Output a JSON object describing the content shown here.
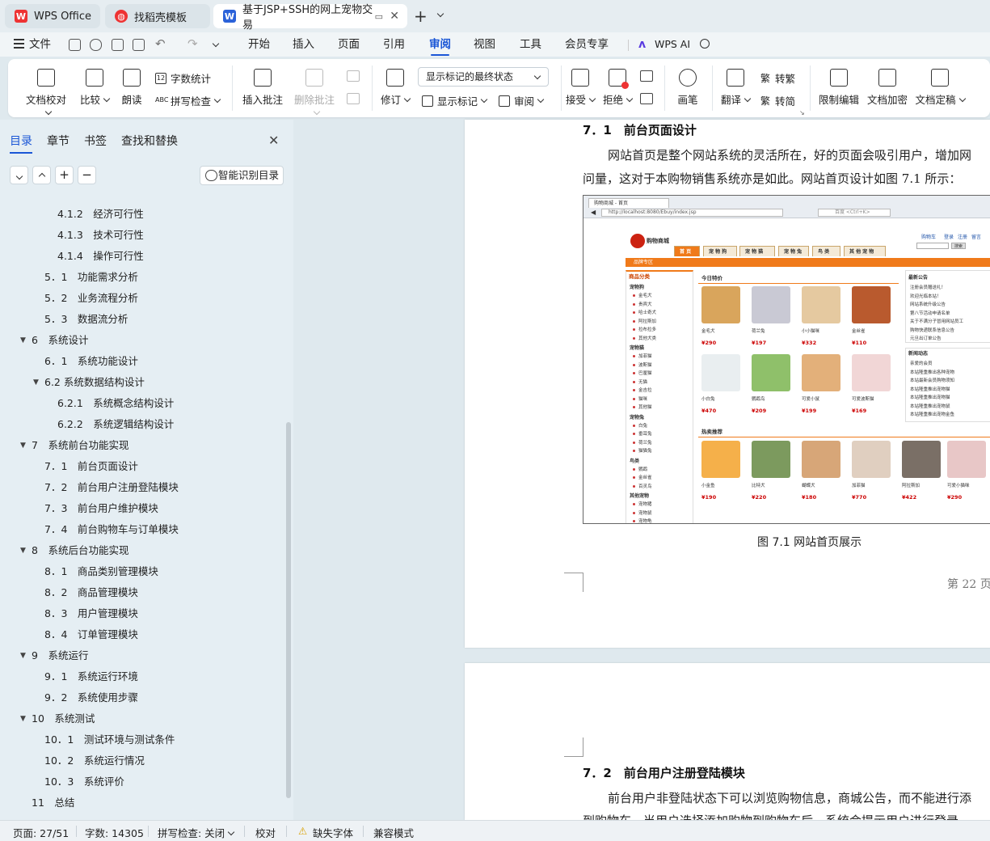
{
  "tabs": [
    {
      "label": "WPS Office"
    },
    {
      "label": "找稻壳模板"
    },
    {
      "label": "基于JSP+SSH的网上宠物交易"
    }
  ],
  "menu": {
    "file": "文件",
    "items": [
      "开始",
      "插入",
      "页面",
      "引用",
      "审阅",
      "视图",
      "工具",
      "会员专享"
    ],
    "active": "审阅",
    "ai": "WPS AI"
  },
  "ribbon": {
    "proofread": "文档校对",
    "compare": "比较",
    "read_aloud": "朗读",
    "word_count": "字数统计",
    "spell_check": "拼写检查",
    "insert_comment": "插入批注",
    "delete_comment": "删除批注",
    "revise": "修订",
    "mark_state": "显示标记的最终状态",
    "show_marks": "显示标记",
    "review": "审阅",
    "accept": "接受",
    "reject": "拒绝",
    "pen": "画笔",
    "translate": "翻译",
    "to_traditional": "转繁",
    "to_simplified": "转简",
    "restrict_edit": "限制编辑",
    "encrypt": "文档加密",
    "finalize": "文档定稿"
  },
  "sidebar": {
    "tabs": [
      "目录",
      "章节",
      "书签",
      "查找和替换"
    ],
    "active_tab": "目录",
    "smart_button": "智能识别目录",
    "toc": [
      {
        "text": "4.1.2　经济可行性",
        "level": 3
      },
      {
        "text": "4.1.3　技术可行性",
        "level": 3
      },
      {
        "text": "4.1.4　操作可行性",
        "level": 3
      },
      {
        "text": "5．1　功能需求分析",
        "level": 2
      },
      {
        "text": "5．2　业务流程分析",
        "level": 2
      },
      {
        "text": "5．3　数据流分析",
        "level": 2
      },
      {
        "text": "6　系统设计",
        "level": 1,
        "expanded": true
      },
      {
        "text": "6．1　系统功能设计",
        "level": 2
      },
      {
        "text": "6.2 系统数据结构设计",
        "level": 2,
        "expanded": true
      },
      {
        "text": "6.2.1　系统概念结构设计",
        "level": 3
      },
      {
        "text": "6.2.2　系统逻辑结构设计",
        "level": 3
      },
      {
        "text": "7　系统前台功能实现",
        "level": 1,
        "expanded": true
      },
      {
        "text": "7．1　前台页面设计",
        "level": 2
      },
      {
        "text": "7．2　前台用户注册登陆模块",
        "level": 2
      },
      {
        "text": "7．3　前台用户维护模块",
        "level": 2
      },
      {
        "text": "7．4　前台购物车与订单模块",
        "level": 2
      },
      {
        "text": "8　系统后台功能实现",
        "level": 1,
        "expanded": true
      },
      {
        "text": "8．1　商品类别管理模块",
        "level": 2
      },
      {
        "text": "8．2　商品管理模块",
        "level": 2
      },
      {
        "text": "8．3　用户管理模块",
        "level": 2
      },
      {
        "text": "8．4　订单管理模块",
        "level": 2
      },
      {
        "text": "9　系统运行",
        "level": 1,
        "expanded": true
      },
      {
        "text": "9．1　系统运行环境",
        "level": 2
      },
      {
        "text": "9．2　系统使用步骤",
        "level": 2
      },
      {
        "text": "10　系统测试",
        "level": 1,
        "expanded": true
      },
      {
        "text": "10．1　测试环境与测试条件",
        "level": 2
      },
      {
        "text": "10．2　系统运行情况",
        "level": 2
      },
      {
        "text": "10．3　系统评价",
        "level": 2
      },
      {
        "text": "11　总结",
        "level": 1
      }
    ]
  },
  "document": {
    "heading1": "7．1　前台页面设计",
    "para1_line1": "网站首页是整个网站系统的灵活所在，好的页面会吸引用户，增加网",
    "para1_line2": "问量，这对于本购物销售系统亦是如此。网站首页设计如图 7.1 所示：",
    "caption": "图 7.1  网站首页展示",
    "page_number": "第 22 页",
    "heading2": "7．2　前台用户注册登陆模块",
    "para2_line1": "前台用户非登陆状态下可以浏览购物信息，商城公告，而不能进行添",
    "para2_line2": "到购物车，当用户选择添加购物到购物车后，系统会提示用户进行登录"
  },
  "figure": {
    "browser_tab": "购物商城 - 首页",
    "url": "http://localhost:8080/Ebuy/index.jsp",
    "search_hint": "百度 <Ctrl+K>",
    "logo_text": "购物商城",
    "top_links": [
      "购物车",
      "登录",
      "注册",
      "留言"
    ],
    "search_btn": "搜索",
    "nav": [
      "首 页",
      "宠 物 狗",
      "宠 物 猫",
      "宠 物 兔",
      "鸟 类",
      "其 他 宠 物"
    ],
    "sub_bar": "品牌专区",
    "category_title": "商品分类",
    "categories": [
      {
        "name": "宠物狗",
        "items": [
          "金毛犬",
          "贵宾犬",
          "哈士奇犬",
          "阿拉斯加",
          "拉布拉多",
          "其他犬类"
        ]
      },
      {
        "name": "宠物猫",
        "items": [
          "加菲猫",
          "波斯猫",
          "巴厘猫",
          "无猫",
          "金吉拉",
          "猫咪",
          "其他猫"
        ]
      },
      {
        "name": "宠物兔",
        "items": [
          "白兔",
          "垂耳兔",
          "荷兰兔",
          "猫猫兔"
        ]
      },
      {
        "name": "鸟类",
        "items": [
          "鹦鹉",
          "金丝雀",
          "百灵鸟"
        ]
      },
      {
        "name": "其他宠物",
        "items": [
          "宠物猪",
          "宠物鼠",
          "宠物龟"
        ]
      }
    ],
    "special_title": "今日特价",
    "special": [
      {
        "name": "金毛犬",
        "price": "¥290"
      },
      {
        "name": "荷兰兔",
        "price": "¥197"
      },
      {
        "name": "小小猫咪",
        "price": "¥332"
      },
      {
        "name": "金丝雀",
        "price": "¥110"
      },
      {
        "name": "小白兔",
        "price": "¥470"
      },
      {
        "name": "鹦鹉鸟",
        "price": "¥209"
      },
      {
        "name": "可爱小鼠",
        "price": "¥199"
      },
      {
        "name": "可爱波斯猫",
        "price": "¥169"
      }
    ],
    "hot_title": "热卖推荐",
    "hot": [
      {
        "name": "小金鱼",
        "price": "¥190"
      },
      {
        "name": "比特犬",
        "price": "¥220"
      },
      {
        "name": "蝴蝶犬",
        "price": "¥180"
      },
      {
        "name": "加菲猫",
        "price": "¥770"
      },
      {
        "name": "阿拉斯加",
        "price": "¥422"
      },
      {
        "name": "可爱小猫咪",
        "price": "¥290"
      }
    ],
    "notice_title": "最新公告",
    "notices": [
      "注册会员赠送礼！",
      "欢迎光临本站！",
      "网站系统升级公告",
      "第八节活动申请名单",
      "关于不满分子冒用网站员工",
      "购物快递联系信息公告",
      "元旦出订单公告"
    ],
    "news_title": "新闻动态",
    "news": [
      "亲爱的会员",
      "本站隆重推出各种宠物",
      "本站最新会员购物须知",
      "本站隆重推出宠物猫",
      "本站隆重推出宠物猫",
      "本站隆重推出宠物鼠",
      "本站隆重推出宠物金鱼"
    ]
  },
  "status": {
    "page": "页面: 27/51",
    "words": "字数: 14305",
    "spell": "拼写检查: 关闭",
    "proof": "校对",
    "missing_font": "缺失字体",
    "compat": "兼容模式"
  },
  "colors": {
    "accent": "#1a56d6",
    "figure_orange": "#f07a1a",
    "price_red": "#cc0000"
  }
}
